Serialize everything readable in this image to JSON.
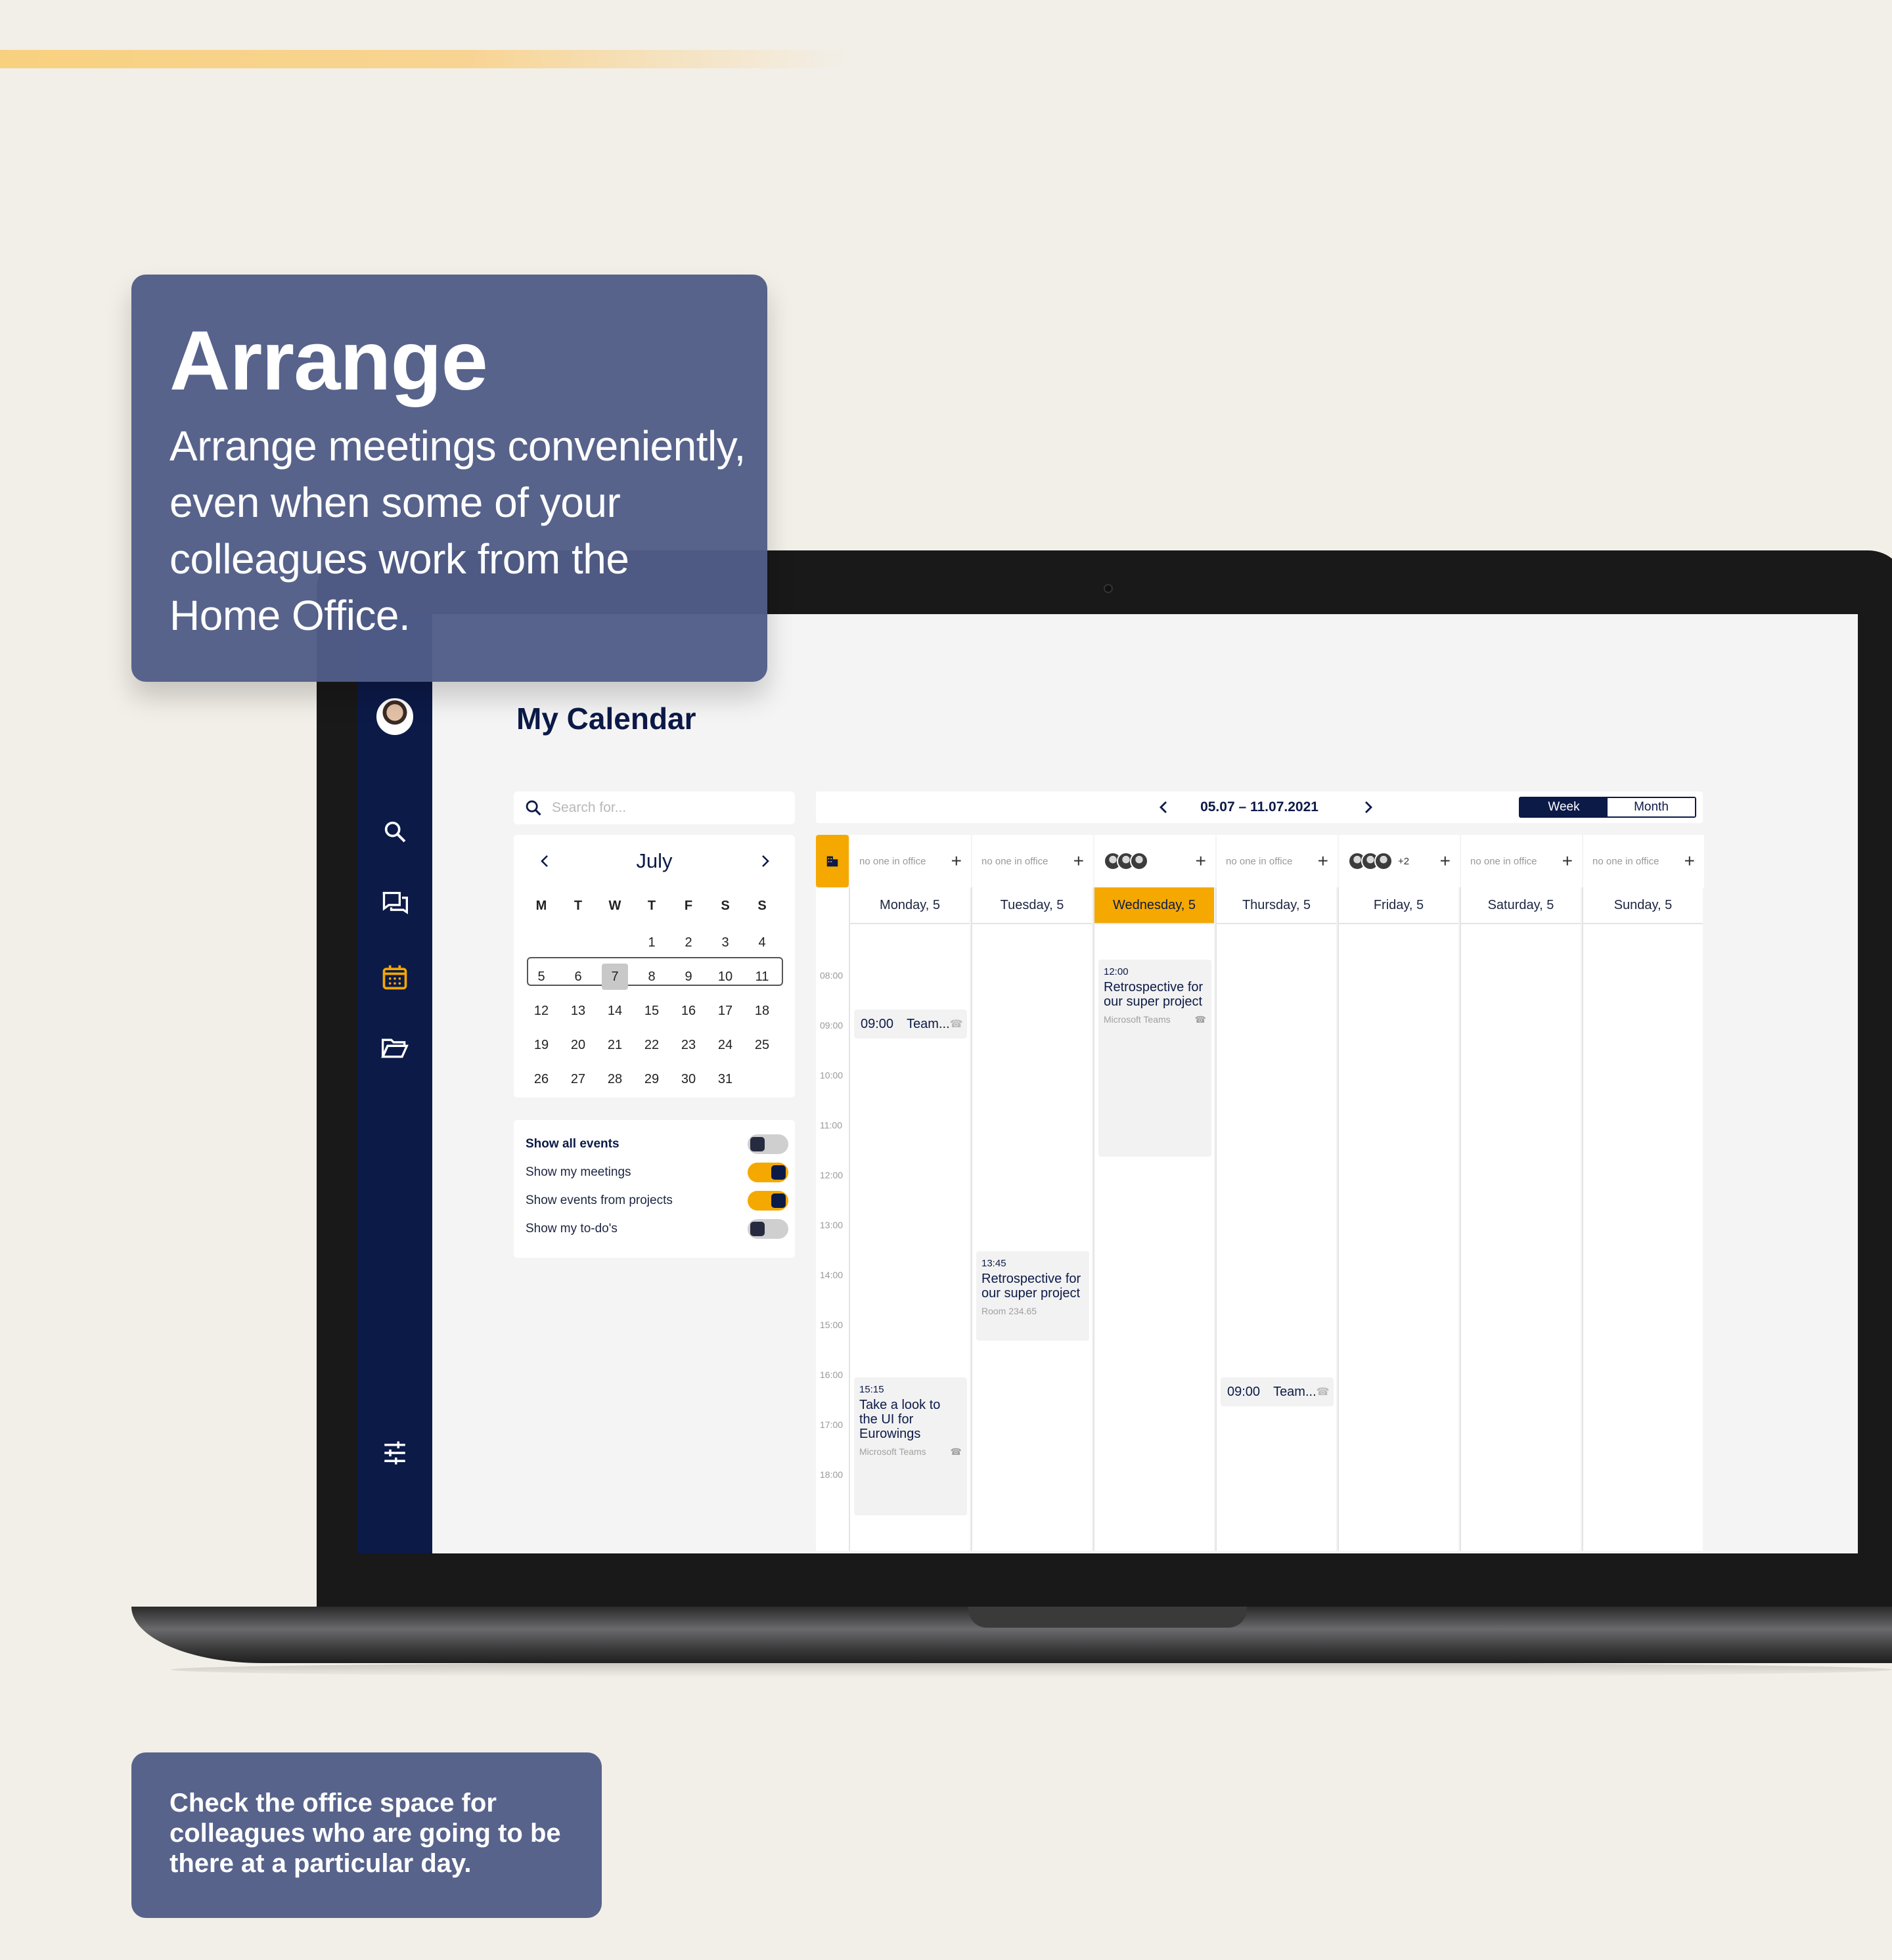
{
  "hero": {
    "title": "Arrange",
    "body": "Arrange meetings conveniently, even when some of your colleagues work from the Home Office."
  },
  "footer_card": {
    "text": "Check the office space for colleagues who are going to be there at a particular day."
  },
  "app": {
    "page_title": "My Calendar",
    "sidebar": [
      "avatar",
      "search-icon",
      "chat-icon",
      "calendar-icon",
      "folder-icon",
      "settings-sliders-icon"
    ],
    "search": {
      "placeholder": "Search for..."
    },
    "mini_calendar": {
      "month": "July",
      "weekdays": [
        "M",
        "T",
        "W",
        "T",
        "F",
        "S",
        "S"
      ],
      "rows": [
        [
          "",
          "",
          "",
          "1",
          "2",
          "3",
          "4"
        ],
        [
          "5",
          "6",
          "7",
          "8",
          "9",
          "10",
          "11"
        ],
        [
          "12",
          "13",
          "14",
          "15",
          "16",
          "17",
          "18"
        ],
        [
          "19",
          "20",
          "21",
          "22",
          "23",
          "24",
          "25"
        ],
        [
          "26",
          "27",
          "28",
          "29",
          "30",
          "31",
          ""
        ]
      ],
      "selected_day": "7"
    },
    "filters": [
      {
        "label": "Show all events",
        "on": false,
        "bold": true
      },
      {
        "label": "Show my meetings",
        "on": true
      },
      {
        "label": "Show events from projects",
        "on": true
      },
      {
        "label": "Show my to-do's",
        "on": false
      }
    ],
    "week": {
      "range": "05.07 – 11.07.2021",
      "view_week": "Week",
      "view_month": "Month",
      "office_status": [
        {
          "text": "no one in office"
        },
        {
          "text": "no one in office"
        },
        {
          "avatars": 3,
          "more": ""
        },
        {
          "text": "no one in office"
        },
        {
          "avatars": 3,
          "more": "+2"
        },
        {
          "text": "no one in office"
        },
        {
          "text": "no one in office"
        }
      ],
      "days": [
        "Monday, 5",
        "Tuesday, 5",
        "Wednesday, 5",
        "Thursday, 5",
        "Friday, 5",
        "Saturday, 5",
        "Sunday, 5"
      ],
      "today_index": 2,
      "hours": [
        "08:00",
        "09:00",
        "10:00",
        "11:00",
        "12:00",
        "13:00",
        "14:00",
        "15:00",
        "16:00",
        "17:00",
        "18:00"
      ],
      "events": [
        {
          "day": "Monday, 5",
          "time": "09:00",
          "title": "Team...",
          "kind": "short"
        },
        {
          "day": "Monday, 5",
          "time": "15:15",
          "title": "Take a look to the UI for Eurowings",
          "location": "Microsoft Teams"
        },
        {
          "day": "Tuesday, 5",
          "time": "13:45",
          "title": "Retrospective for our super project",
          "location": "Room 234.65"
        },
        {
          "day": "Wednesday, 5",
          "time": "12:00",
          "title": "Retrospective for our super project",
          "location": "Microsoft Teams"
        },
        {
          "day": "Thursday, 5",
          "time": "09:00",
          "title": "Team...",
          "kind": "short"
        }
      ]
    }
  },
  "colors": {
    "navy": "#0c1a48",
    "accent": "#f5a800",
    "card": "#505d87",
    "background": "#f2efe8"
  }
}
